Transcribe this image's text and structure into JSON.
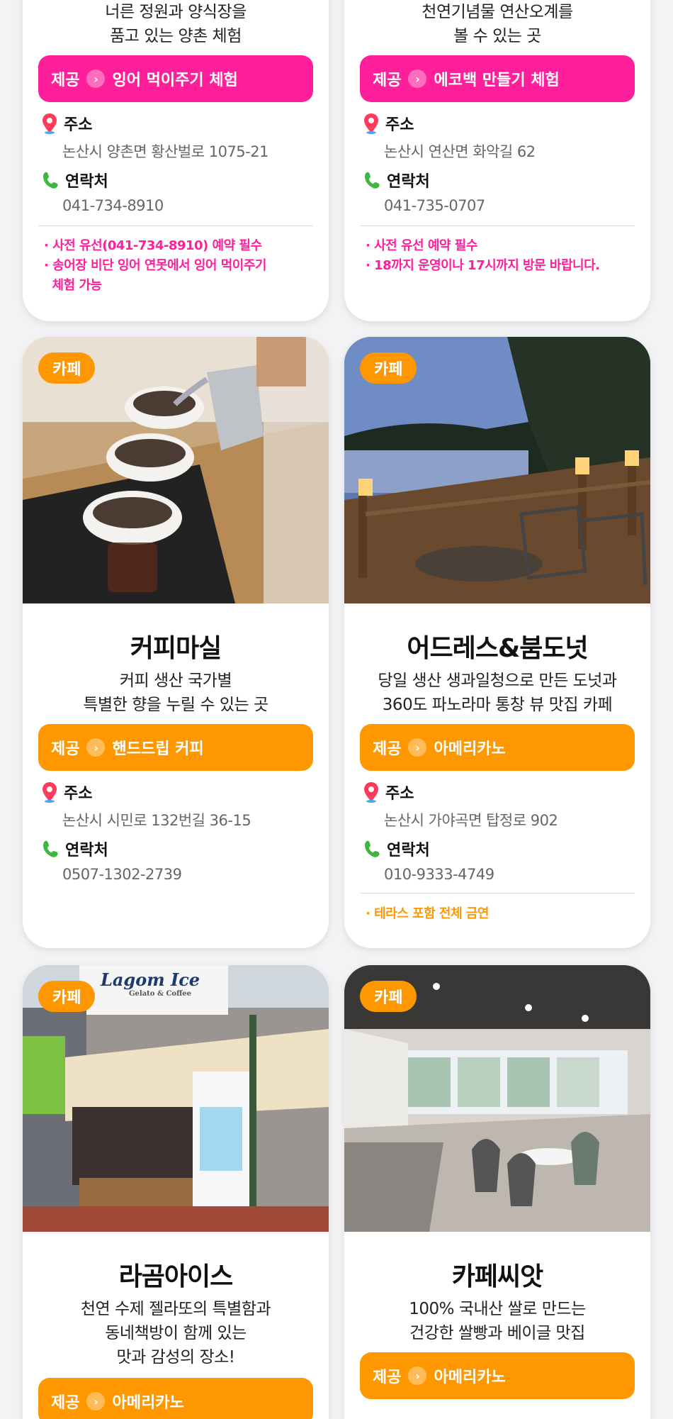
{
  "cards": [
    {
      "desc_lines": [
        "너른 정원과 양식장을",
        "품고 있는 양촌 체험"
      ],
      "provide_label": "제공",
      "provide_item": "잉어 먹이주기 체험",
      "address_label": "주소",
      "address": "논산시 양촌면 황산벌로 1075-21",
      "contact_label": "연락처",
      "phone": "041-734-8910",
      "notes": [
        "· 사전 유선(041-734-8910) 예약 필수",
        "· 송어장 비단 잉어 연못에서 잉어 먹이주기",
        "  체험 가능"
      ]
    },
    {
      "desc_lines": [
        "천연기념물 연산오계를",
        "볼 수 있는 곳"
      ],
      "provide_label": "제공",
      "provide_item": "에코백 만들기 체험",
      "address_label": "주소",
      "address": "논산시 연산면 화악길 62",
      "contact_label": "연락처",
      "phone": "041-735-0707",
      "notes": [
        "· 사전 유선 예약 필수",
        "· 18까지 운영이나 17시까지 방문 바랍니다."
      ]
    },
    {
      "tag": "카페",
      "name": "커피마실",
      "desc_lines": [
        "커피 생산 국가별",
        "특별한 향을 누릴 수 있는 곳"
      ],
      "provide_label": "제공",
      "provide_item": "핸드드립 커피",
      "address_label": "주소",
      "address": "논산시 시민로 132번길 36-15",
      "contact_label": "연락처",
      "phone": "0507-1302-2739"
    },
    {
      "tag": "카페",
      "name": "어드레스&붐도넛",
      "desc_lines": [
        "당일 생산 생과일청으로 만든 도넛과",
        "360도 파노라마 통창 뷰 맛집 카페"
      ],
      "provide_label": "제공",
      "provide_item": "아메리카노",
      "address_label": "주소",
      "address": "논산시 가야곡면 탑정로 902",
      "contact_label": "연락처",
      "phone": "010-9333-4749",
      "notes": [
        "· 테라스 포함 전체 금연"
      ]
    },
    {
      "tag": "카페",
      "name": "라곰아이스",
      "desc_lines": [
        "천연 수제 젤라또의 특별함과",
        "동네책방이 함께 있는",
        "맛과 감성의 장소!"
      ],
      "provide_label": "제공",
      "provide_item": "아메리카노",
      "image_texts": {
        "sign": "Lagom Ice",
        "sign_sub": "Gelato & Coffee"
      }
    },
    {
      "tag": "카페",
      "name": "카페씨앗",
      "desc_lines": [
        "100% 국내산 쌀로 만드는",
        "건강한 쌀빵과 베이글 맛집"
      ],
      "provide_label": "제공",
      "provide_item": "아메리카노"
    }
  ],
  "colors": {
    "pink": "#ff1f9a",
    "orange": "#ff9800",
    "pin": "#ff3b5c",
    "phone_icon": "#3fb63f"
  },
  "icons": {
    "address": "map-pin-icon",
    "contact": "phone-icon",
    "arrow": "chevron-right-icon"
  }
}
